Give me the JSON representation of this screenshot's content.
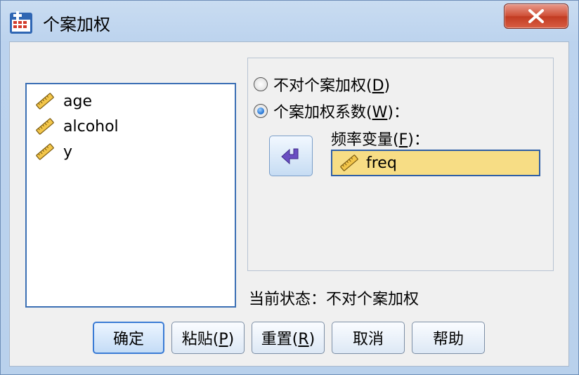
{
  "window": {
    "title": "个案加权"
  },
  "variables": [
    {
      "name": "age"
    },
    {
      "name": "alcohol"
    },
    {
      "name": "y"
    }
  ],
  "options": {
    "no_weight": {
      "text": "不对个案加权(",
      "key": "D",
      "close": ")",
      "checked": false
    },
    "weight_by": {
      "text": "个案加权系数(",
      "key": "W",
      "close": ")：",
      "checked": true
    }
  },
  "freq_variable": {
    "label_text": "频率变量(",
    "label_key": "F",
    "label_close": ")：",
    "value": "freq"
  },
  "status": {
    "text": "当前状态：不对个案加权"
  },
  "buttons": {
    "ok": "确定",
    "paste_text": "粘贴(",
    "paste_key": "P",
    "paste_close": ")",
    "reset_text": "重置(",
    "reset_key": "R",
    "reset_close": ")",
    "cancel": "取消",
    "help": "帮助"
  },
  "icons": {
    "app": "spss-table-icon",
    "scale_variable": "ruler-icon",
    "move": "arrow-left-icon",
    "close": "close-icon"
  },
  "colors": {
    "field_highlight": "#f7dd85",
    "focus_border": "#2e5ea6",
    "close_button": "#c23b22"
  }
}
